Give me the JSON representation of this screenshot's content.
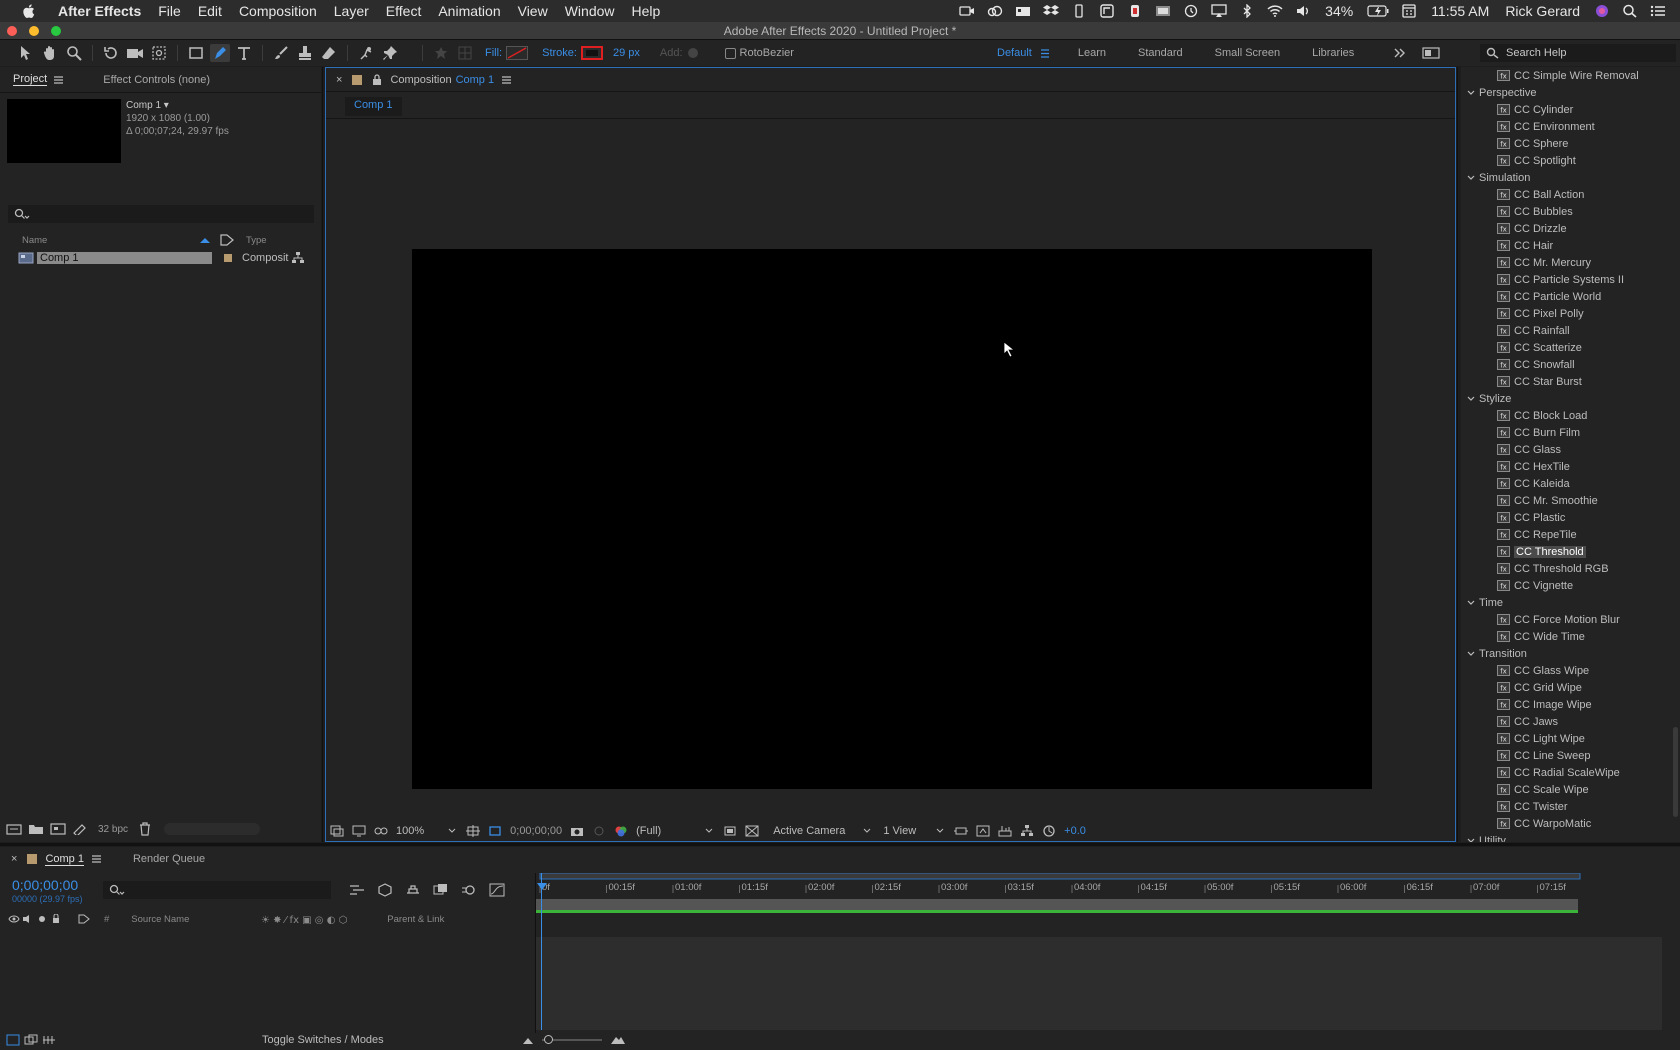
{
  "menubar": {
    "app_name": "After Effects",
    "menus": [
      "File",
      "Edit",
      "Composition",
      "Layer",
      "Effect",
      "Animation",
      "View",
      "Window",
      "Help"
    ],
    "battery": "34%",
    "time": "11:55 AM",
    "user": "Rick Gerard"
  },
  "window": {
    "title": "Adobe After Effects 2020 - Untitled Project *"
  },
  "toolbar": {
    "fill_label": "Fill:",
    "stroke_label": "Stroke:",
    "stroke_width": "29 px",
    "add_label": "Add:",
    "rotobezier_label": "RotoBezier",
    "workspaces": [
      "Default",
      "Learn",
      "Standard",
      "Small Screen",
      "Libraries"
    ],
    "active_workspace": "Default",
    "search_help_placeholder": "Search Help",
    "stroke_color": "#e02020",
    "accent_color": "#3a8ee6"
  },
  "project_panel": {
    "tabs": [
      "Project",
      "Effect Controls (none)"
    ],
    "selected_item": {
      "name": "Comp 1 ▾",
      "dimensions": "1920 x 1080 (1.00)",
      "duration": "Δ 0;00;07;24, 29.97 fps"
    },
    "columns": {
      "name": "Name",
      "type": "Type"
    },
    "items": [
      {
        "name": "Comp 1",
        "type": "Composit"
      }
    ],
    "bit_depth": "32 bpc"
  },
  "composition_panel": {
    "header_prefix": "Composition",
    "header_name": "Comp 1",
    "subtab": "Comp 1",
    "zoom": "100%",
    "timecode": "0;00;00;00",
    "resolution": "(Full)",
    "camera": "Active Camera",
    "views": "1 View",
    "exposure": "+0.0"
  },
  "effects_panel": {
    "entries": [
      {
        "kind": "item",
        "label": "CC Simple Wire Removal"
      },
      {
        "kind": "cat",
        "label": "Perspective"
      },
      {
        "kind": "item",
        "label": "CC Cylinder"
      },
      {
        "kind": "item",
        "label": "CC Environment"
      },
      {
        "kind": "item",
        "label": "CC Sphere"
      },
      {
        "kind": "item",
        "label": "CC Spotlight"
      },
      {
        "kind": "cat",
        "label": "Simulation"
      },
      {
        "kind": "item",
        "label": "CC Ball Action"
      },
      {
        "kind": "item",
        "label": "CC Bubbles"
      },
      {
        "kind": "item",
        "label": "CC Drizzle"
      },
      {
        "kind": "item",
        "label": "CC Hair"
      },
      {
        "kind": "item",
        "label": "CC Mr. Mercury"
      },
      {
        "kind": "item",
        "label": "CC Particle Systems II"
      },
      {
        "kind": "item",
        "label": "CC Particle World"
      },
      {
        "kind": "item",
        "label": "CC Pixel Polly"
      },
      {
        "kind": "item",
        "label": "CC Rainfall"
      },
      {
        "kind": "item",
        "label": "CC Scatterize"
      },
      {
        "kind": "item",
        "label": "CC Snowfall"
      },
      {
        "kind": "item",
        "label": "CC Star Burst"
      },
      {
        "kind": "cat",
        "label": "Stylize"
      },
      {
        "kind": "item",
        "label": "CC Block Load"
      },
      {
        "kind": "item",
        "label": "CC Burn Film"
      },
      {
        "kind": "item",
        "label": "CC Glass"
      },
      {
        "kind": "item",
        "label": "CC HexTile"
      },
      {
        "kind": "item",
        "label": "CC Kaleida"
      },
      {
        "kind": "item",
        "label": "CC Mr. Smoothie"
      },
      {
        "kind": "item",
        "label": "CC Plastic"
      },
      {
        "kind": "item",
        "label": "CC RepeTile"
      },
      {
        "kind": "item",
        "label": "CC Threshold",
        "selected": true
      },
      {
        "kind": "item",
        "label": "CC Threshold RGB"
      },
      {
        "kind": "item",
        "label": "CC Vignette"
      },
      {
        "kind": "cat",
        "label": "Time"
      },
      {
        "kind": "item",
        "label": "CC Force Motion Blur"
      },
      {
        "kind": "item",
        "label": "CC Wide Time"
      },
      {
        "kind": "cat",
        "label": "Transition"
      },
      {
        "kind": "item",
        "label": "CC Glass Wipe"
      },
      {
        "kind": "item",
        "label": "CC Grid Wipe"
      },
      {
        "kind": "item",
        "label": "CC Image Wipe"
      },
      {
        "kind": "item",
        "label": "CC Jaws"
      },
      {
        "kind": "item",
        "label": "CC Light Wipe"
      },
      {
        "kind": "item",
        "label": "CC Line Sweep"
      },
      {
        "kind": "item",
        "label": "CC Radial ScaleWipe"
      },
      {
        "kind": "item",
        "label": "CC Scale Wipe"
      },
      {
        "kind": "item",
        "label": "CC Twister"
      },
      {
        "kind": "item",
        "label": "CC WarpoMatic"
      },
      {
        "kind": "cat",
        "label": "Utility"
      }
    ]
  },
  "timeline": {
    "tabs": [
      "Comp 1",
      "Render Queue"
    ],
    "timecode": "0;00;00;00",
    "frame_info": "00000 (29.97 fps)",
    "columns": {
      "number": "#",
      "source_name": "Source Name",
      "parent": "Parent & Link"
    },
    "ruler_labels": [
      "0f",
      "00:15f",
      "01:00f",
      "01:15f",
      "02:00f",
      "02:15f",
      "03:00f",
      "03:15f",
      "04:00f",
      "04:15f",
      "05:00f",
      "05:15f",
      "06:00f",
      "06:15f",
      "07:00f",
      "07:15f"
    ],
    "toggle_label": "Toggle Switches / Modes",
    "work_area_color": "#3cb43c"
  }
}
